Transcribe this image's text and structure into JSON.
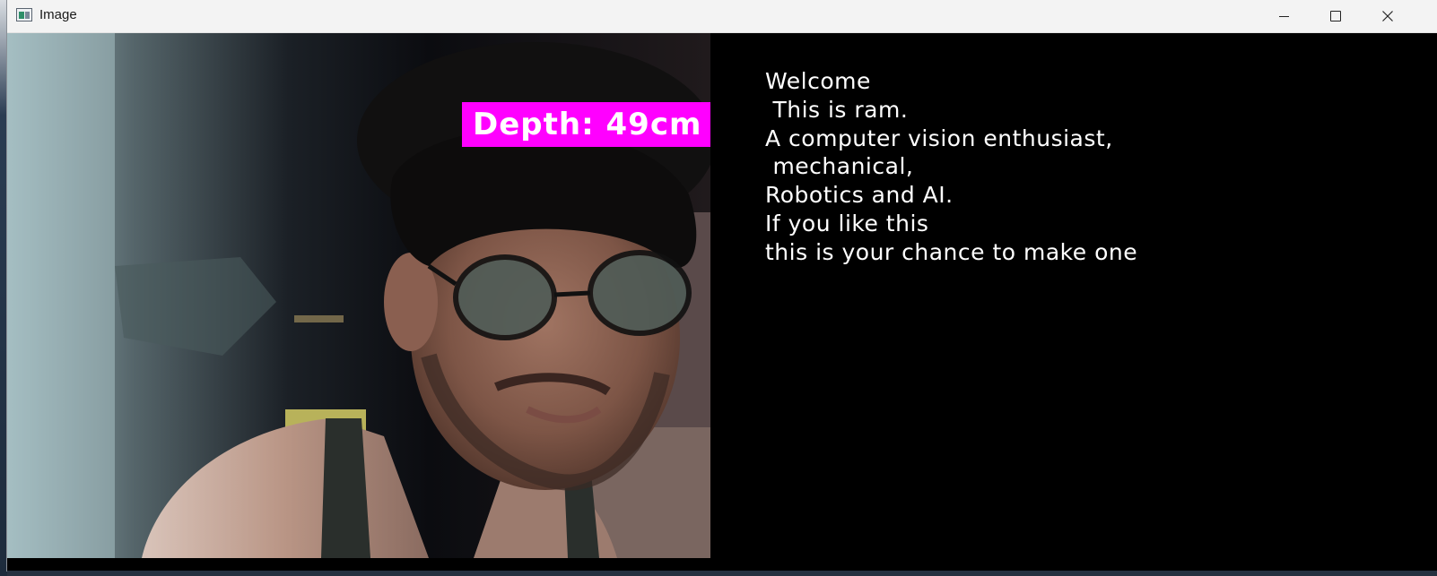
{
  "window": {
    "title": "Image",
    "icon": "image-viewer-icon",
    "controls": [
      "minimize-icon",
      "maximize-icon",
      "close-icon"
    ]
  },
  "camera": {
    "depth_label": "Depth: 49cm",
    "label_color": "#ff00ff"
  },
  "info_panel": {
    "lines": [
      "Welcome",
      " This is ram.",
      "A computer vision enthusiast,",
      " mechanical,",
      "Robotics and AI.",
      "If you like this",
      "this is your chance to make one"
    ]
  }
}
